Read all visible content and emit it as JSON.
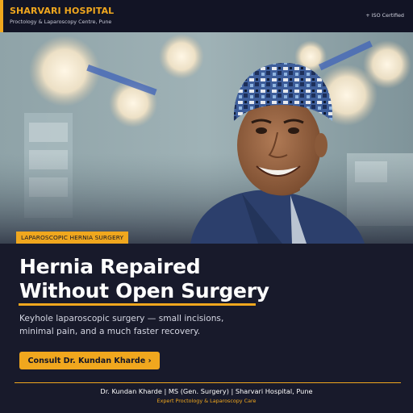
{
  "header": {
    "brand": "SHARVARI HOSPITAL",
    "subtitle": "Proctology & Laparoscopy Centre, Pune",
    "badge": "+ ISO Certified"
  },
  "hero": {
    "tag": "LAPAROSCOPIC HERNIA SURGERY",
    "headline_line1": "Hernia Repaired",
    "headline_line2": "Without Open Surgery",
    "description_line1": "Keyhole laparoscopic surgery — small incisions,",
    "description_line2": "minimal pain, and a much faster recovery.",
    "cta_label": "Consult Dr. Kundan Kharde ›"
  },
  "footer": {
    "credentials": "Dr. Kundan Kharde  |  MS (Gen. Surgery)  |  Sharvari Hospital, Pune",
    "tagline": "Expert Proctology & Laparoscopy Care"
  },
  "colors": {
    "accent": "#f0a71e",
    "background": "#181a2b",
    "header_bg": "#121425"
  }
}
